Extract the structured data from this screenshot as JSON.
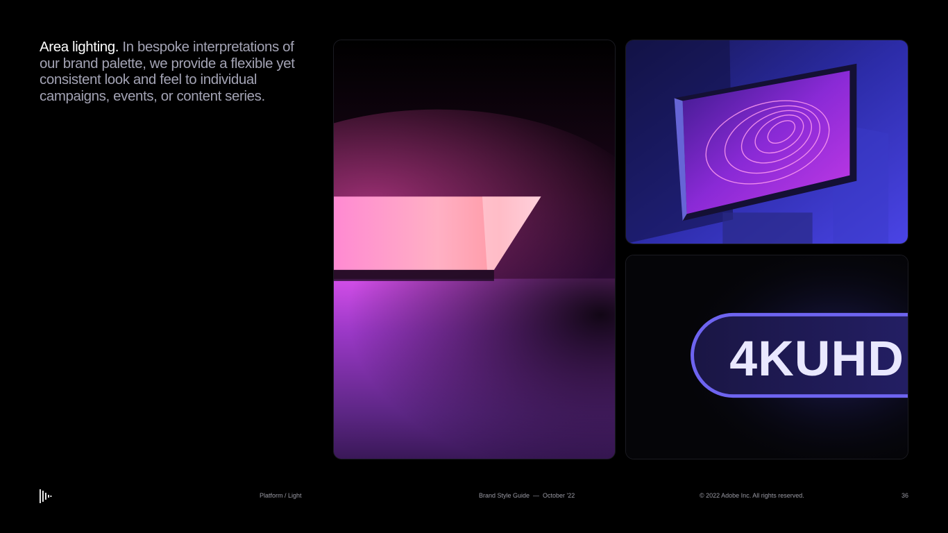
{
  "intro": {
    "lead": "Area lighting.",
    "body": " In bespoke interpretations of our brand palette, we provide a flexible yet consistent look and feel to individual campaigns, events, or content series."
  },
  "tiles": {
    "light_bar": {
      "icon": "light-bar-scene"
    },
    "monitor": {
      "icon": "monitor-scene"
    },
    "badge": {
      "text": "4KUHD"
    }
  },
  "footer": {
    "logo_icon": "brand-mark-icon",
    "section": "Platform / Light",
    "guide": "Brand Style Guide  —  October '22",
    "copyright": "© 2022 Adobe Inc. All rights reserved.",
    "page_number": "36"
  },
  "colors": {
    "background": "#000000",
    "text_primary": "#ffffff",
    "text_muted": "#a3a3b4",
    "accent_pink": "#ff7fc8",
    "accent_purple": "#7a3cff",
    "accent_blue": "#3d3dd6"
  }
}
